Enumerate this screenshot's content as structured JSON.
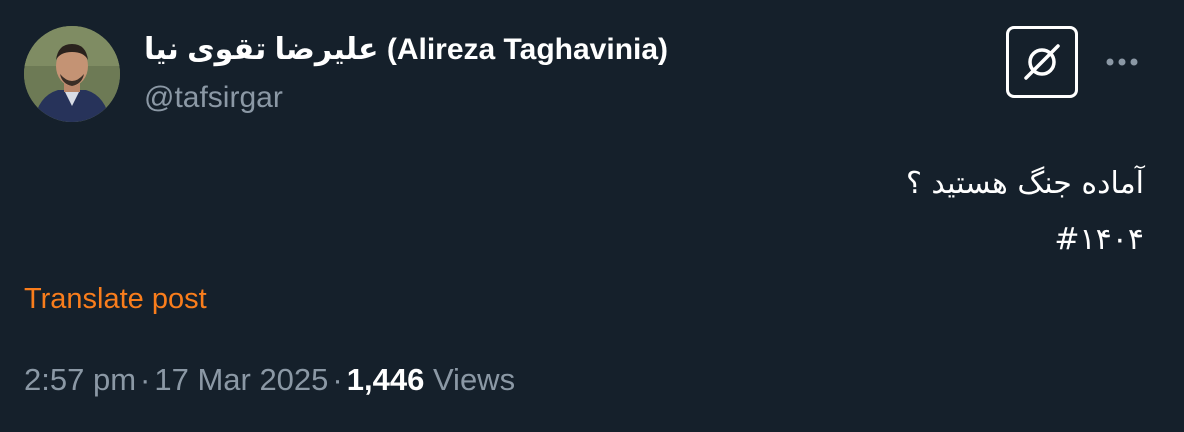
{
  "author": {
    "display_name": "علیرضا تقوی نیا (Alireza Taghavinia)",
    "handle": "@tafsirgar"
  },
  "actions": {
    "grok_icon": "grok-icon",
    "more_icon": "more-icon"
  },
  "post": {
    "lines": [
      "آماده جنگ هستید ؟",
      "#۱۴۰۴"
    ]
  },
  "translate_label": "Translate post",
  "meta": {
    "time": "2:57 pm",
    "separator": "·",
    "date": "17 Mar 2025",
    "views_count": "1,446",
    "views_label": "Views"
  },
  "colors": {
    "background": "#15202b",
    "secondary_text": "#8b98a5",
    "translate_link": "#f97d1c"
  }
}
